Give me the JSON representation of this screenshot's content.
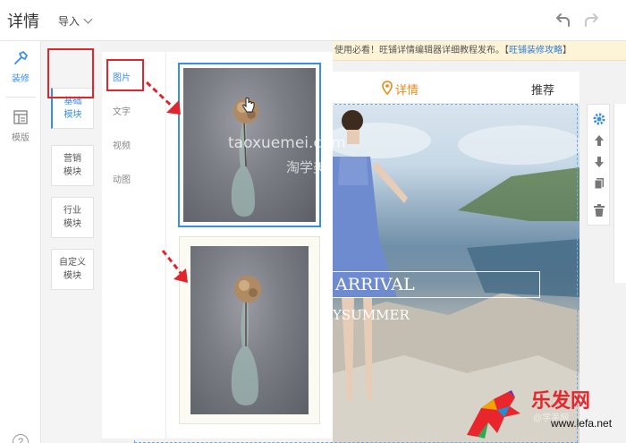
{
  "header": {
    "title": "详情",
    "import_label": "导入"
  },
  "rail": {
    "decorate_label": "装修",
    "template_label": "模版",
    "help_label": "?"
  },
  "categories": [
    {
      "label": "基础\n模块",
      "active": true
    },
    {
      "label": "营销\n模块",
      "active": false
    },
    {
      "label": "行业\n模块",
      "active": false
    },
    {
      "label": "自定义\n模块",
      "active": false
    }
  ],
  "submenu": [
    {
      "label": "图片",
      "active": true
    },
    {
      "label": "文字",
      "active": false
    },
    {
      "label": "视频",
      "active": false
    },
    {
      "label": "动图",
      "active": false
    }
  ],
  "notice": {
    "text": "使用必看！旺铺详情编辑器详细教程发布。",
    "bracket_open": "【",
    "link": "旺铺装修攻略",
    "bracket_close": "】"
  },
  "canvas": {
    "tab_detail": "详情",
    "tab_recommend": "推荐",
    "banner_line1": "ARRIVAL",
    "banner_line2": "YSUMMER"
  },
  "watermark": {
    "site": "taoxuemei.com",
    "cn": "淘学美",
    "logo_text": "乐发网",
    "logo_url": "www.lefa.net",
    "logo_faint": "@学美网"
  },
  "colors": {
    "accent": "#3a8ee6",
    "highlight_red": "#e0262c",
    "tab_orange": "#e88b17"
  }
}
